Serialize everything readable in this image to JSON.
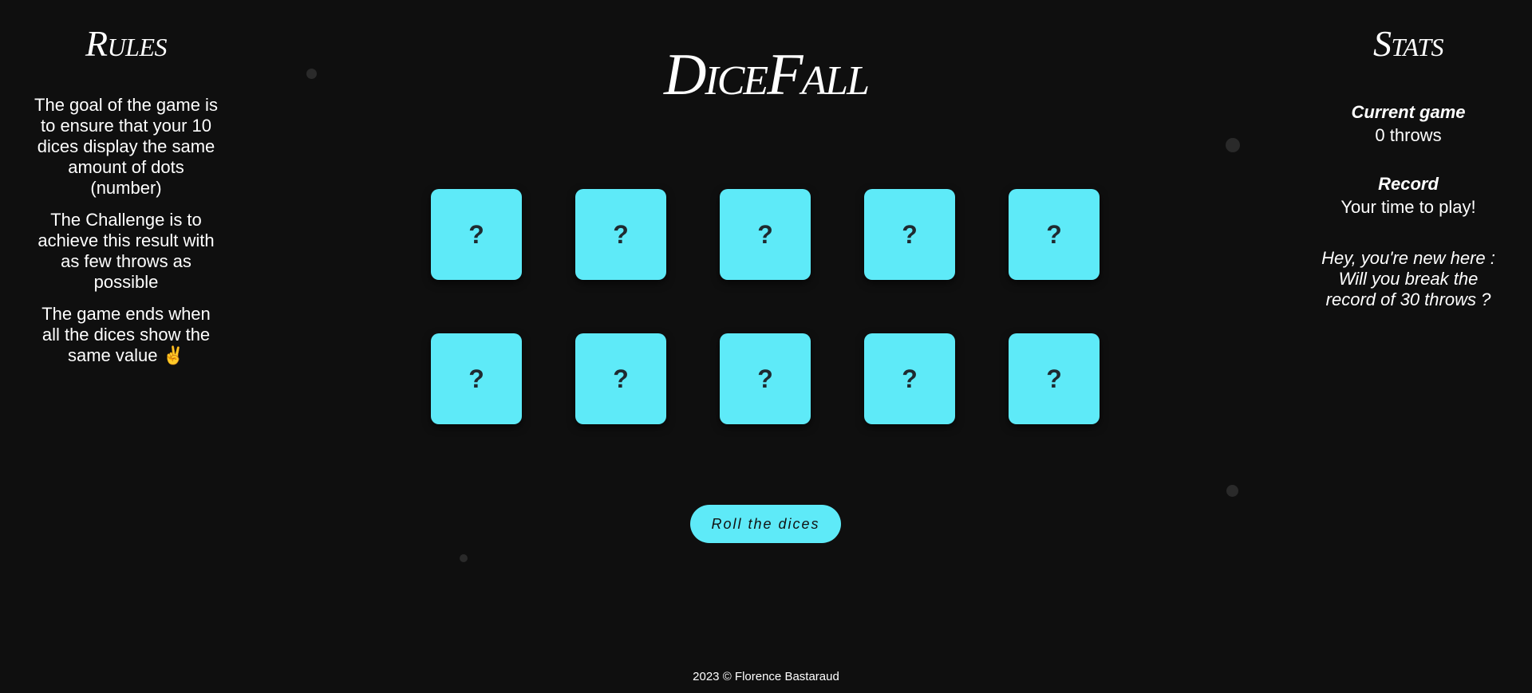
{
  "rules": {
    "title": "Rules",
    "paragraphs": [
      "The goal of the game is to ensure that your 10 dices display the same amount of dots (number)",
      "The Challenge is to achieve this result with as few throws as possible",
      "The game ends when all the dices show the same value ✌️"
    ]
  },
  "game": {
    "title": "DiceFall",
    "dice": [
      "?",
      "?",
      "?",
      "?",
      "?",
      "?",
      "?",
      "?",
      "?",
      "?"
    ],
    "roll_label": "Roll the dices"
  },
  "stats": {
    "title": "Stats",
    "current_label": "Current game",
    "current_value": "0 throws",
    "record_label": "Record",
    "record_value": "Your time to play!",
    "note": "Hey, you're new here : Will you break the record of 30 throws ?"
  },
  "footer": {
    "text": "2023 © Florence Bastaraud"
  },
  "colors": {
    "background": "#0f0f0f",
    "accent": "#5eeaf8",
    "text": "#ffffff"
  }
}
